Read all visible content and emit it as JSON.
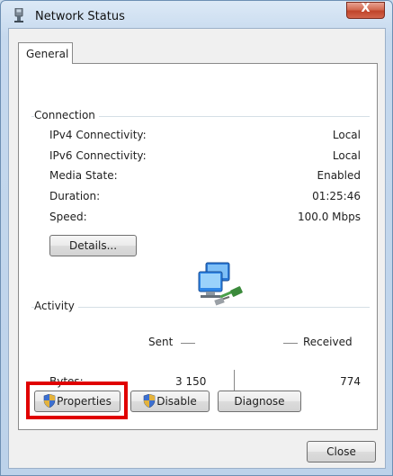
{
  "window": {
    "title": "Network Status",
    "close_glyph": "X"
  },
  "tabs": [
    {
      "label": "General",
      "selected": true
    }
  ],
  "connection": {
    "heading": "Connection",
    "rows": [
      {
        "label": "IPv4 Connectivity:",
        "value": "Local"
      },
      {
        "label": "IPv6 Connectivity:",
        "value": "Local"
      },
      {
        "label": "Media State:",
        "value": "Enabled"
      },
      {
        "label": "Duration:",
        "value": "01:25:46"
      },
      {
        "label": "Speed:",
        "value": "100.0 Mbps"
      }
    ],
    "details_button": "Details..."
  },
  "activity": {
    "heading": "Activity",
    "sent_label": "Sent",
    "received_label": "Received",
    "bytes_label": "Bytes:",
    "bytes_sent": "3 150",
    "bytes_received": "774"
  },
  "buttons": {
    "properties": "Properties",
    "disable": "Disable",
    "diagnose": "Diagnose",
    "close": "Close"
  },
  "colors": {
    "highlight": "#e00000",
    "title_close": "#c0442a"
  },
  "icons": {
    "title": "network-adapter-icon",
    "activity": "network-computers-icon",
    "shield": "uac-shield-icon"
  }
}
